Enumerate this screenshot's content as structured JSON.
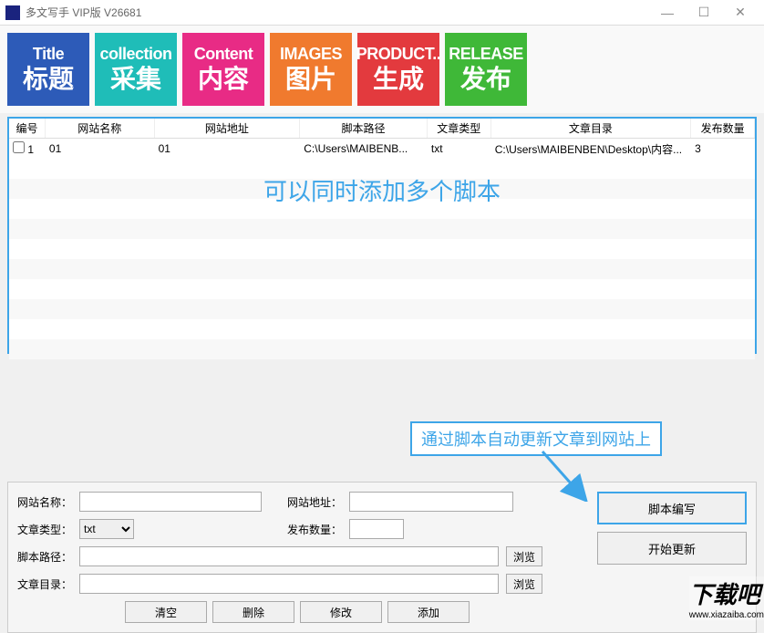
{
  "window": {
    "title": "多文写手 VIP版    V26681"
  },
  "toolbar": [
    {
      "en": "Title",
      "cn": "标题"
    },
    {
      "en": "collection",
      "cn": "采集"
    },
    {
      "en": "Content",
      "cn": "内容"
    },
    {
      "en": "IMAGES",
      "cn": "图片"
    },
    {
      "en": "PRODUCT..",
      "cn": "生成"
    },
    {
      "en": "RELEASE",
      "cn": "发布"
    }
  ],
  "grid": {
    "headers": [
      "编号",
      "网站名称",
      "网站地址",
      "脚本路径",
      "文章类型",
      "文章目录",
      "发布数量"
    ],
    "rows": [
      {
        "id": "1",
        "name": "01",
        "addr": "01",
        "script": "C:\\Users\\MAIBENB...",
        "type": "txt",
        "dir": "C:\\Users\\MAIBENBEN\\Desktop\\内容...",
        "count": "3"
      }
    ],
    "overlay": "可以同时添加多个脚本"
  },
  "callout": "通过脚本自动更新文章到网站上",
  "form": {
    "labels": {
      "siteName": "网站名称：",
      "siteAddr": "网站地址：",
      "type": "文章类型：",
      "count": "发布数量：",
      "script": "脚本路径：",
      "dir": "文章目录："
    },
    "typeValue": "txt",
    "browse": "浏览",
    "buttons": {
      "clear": "清空",
      "delete": "删除",
      "modify": "修改",
      "add": "添加"
    },
    "right": {
      "scriptEdit": "脚本编写",
      "startUpdate": "开始更新"
    }
  },
  "watermark": {
    "big": "下载吧",
    "small": "www.xiazaiba.com"
  }
}
